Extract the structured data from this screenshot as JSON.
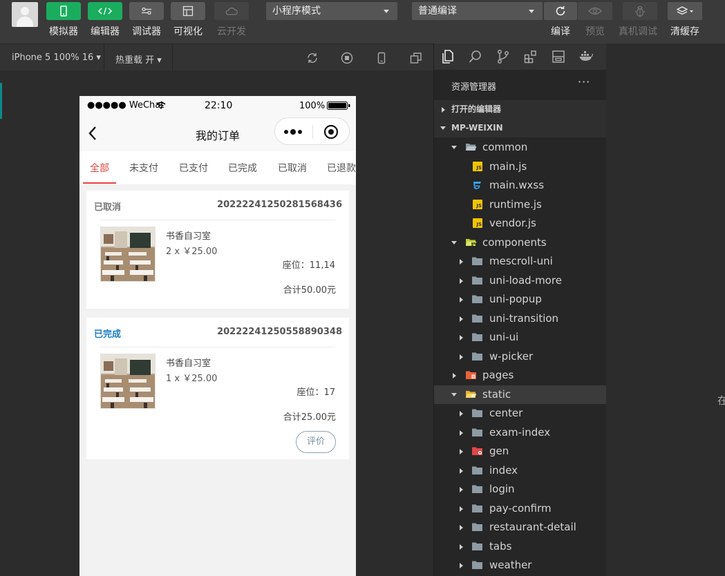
{
  "toolbar": {
    "tools": [
      {
        "label": "模拟器",
        "icon": "phone-icon",
        "state": "active"
      },
      {
        "label": "编辑器",
        "icon": "code-icon",
        "state": "active"
      },
      {
        "label": "调试器",
        "icon": "debug-switch-icon",
        "state": "normal"
      },
      {
        "label": "可视化",
        "icon": "layout-icon",
        "state": "normal"
      },
      {
        "label": "云开发",
        "icon": "cloud-icon",
        "state": "disabled"
      }
    ],
    "mode_select": "小程序模式",
    "compile_select": "普通编译",
    "actions": [
      {
        "label": "编译",
        "icon": "refresh-icon",
        "state": "normal"
      },
      {
        "label": "预览",
        "icon": "eye-icon",
        "state": "disabled"
      },
      {
        "label": "真机调试",
        "icon": "bug-icon",
        "state": "disabled"
      },
      {
        "label": "清缓存",
        "icon": "layers-icon",
        "state": "normal"
      }
    ]
  },
  "simulator": {
    "device": "iPhone 5 100% 16",
    "hot_reload": "热重载 开",
    "status": {
      "carrier": "●●●●● WeChat",
      "time": "22:10",
      "battery": "100%"
    },
    "nav_title": "我的订单",
    "tabs": [
      "全部",
      "未支付",
      "已支付",
      "已完成",
      "已取消",
      "已退款"
    ],
    "active_tab": 0,
    "orders": [
      {
        "status": "已取消",
        "status_color": "#777777",
        "order_no": "20222241250281568436",
        "product": "书香自习室",
        "qty": "2 x ￥25.00",
        "seat": "座位：11,14",
        "total": "合计50.00元",
        "action": ""
      },
      {
        "status": "已完成",
        "status_color": "#1a7dc7",
        "order_no": "20222241250558890348",
        "product": "书香自习室",
        "qty": "1 x ￥25.00",
        "seat": "座位：17",
        "total": "合计25.00元",
        "action": "评价"
      }
    ]
  },
  "explorer": {
    "title": "资源管理器",
    "more": "···",
    "sections": [
      "打开的编辑器",
      "MP-WEIXIN"
    ],
    "tree": [
      {
        "label": "common",
        "depth": 1,
        "type": "folder-open",
        "expanded": true
      },
      {
        "label": "main.js",
        "depth": 2,
        "type": "js"
      },
      {
        "label": "main.wxss",
        "depth": 2,
        "type": "css"
      },
      {
        "label": "runtime.js",
        "depth": 2,
        "type": "js"
      },
      {
        "label": "vendor.js",
        "depth": 2,
        "type": "js"
      },
      {
        "label": "components",
        "depth": 1,
        "type": "folder-components",
        "expanded": true
      },
      {
        "label": "mescroll-uni",
        "depth": 2,
        "type": "folder",
        "expanded": false
      },
      {
        "label": "uni-load-more",
        "depth": 2,
        "type": "folder",
        "expanded": false
      },
      {
        "label": "uni-popup",
        "depth": 2,
        "type": "folder",
        "expanded": false
      },
      {
        "label": "uni-transition",
        "depth": 2,
        "type": "folder",
        "expanded": false
      },
      {
        "label": "uni-ui",
        "depth": 2,
        "type": "folder",
        "expanded": false
      },
      {
        "label": "w-picker",
        "depth": 2,
        "type": "folder",
        "expanded": false
      },
      {
        "label": "pages",
        "depth": 1,
        "type": "folder-pages",
        "expanded": false
      },
      {
        "label": "static",
        "depth": 1,
        "type": "folder-static",
        "expanded": true,
        "selected": true
      },
      {
        "label": "center",
        "depth": 2,
        "type": "folder",
        "expanded": false
      },
      {
        "label": "exam-index",
        "depth": 2,
        "type": "folder",
        "expanded": false
      },
      {
        "label": "gen",
        "depth": 2,
        "type": "folder-gen",
        "expanded": false
      },
      {
        "label": "index",
        "depth": 2,
        "type": "folder",
        "expanded": false
      },
      {
        "label": "login",
        "depth": 2,
        "type": "folder",
        "expanded": false
      },
      {
        "label": "pay-confirm",
        "depth": 2,
        "type": "folder",
        "expanded": false
      },
      {
        "label": "restaurant-detail",
        "depth": 2,
        "type": "folder",
        "expanded": false
      },
      {
        "label": "tabs",
        "depth": 2,
        "type": "folder",
        "expanded": false
      },
      {
        "label": "weather",
        "depth": 2,
        "type": "folder",
        "expanded": false
      }
    ]
  },
  "right_panel": {
    "edge_text": "在"
  },
  "colors": {
    "accent_green": "#1aad5e",
    "tab_active": "#e64340",
    "completed_blue": "#1a7dc7"
  }
}
